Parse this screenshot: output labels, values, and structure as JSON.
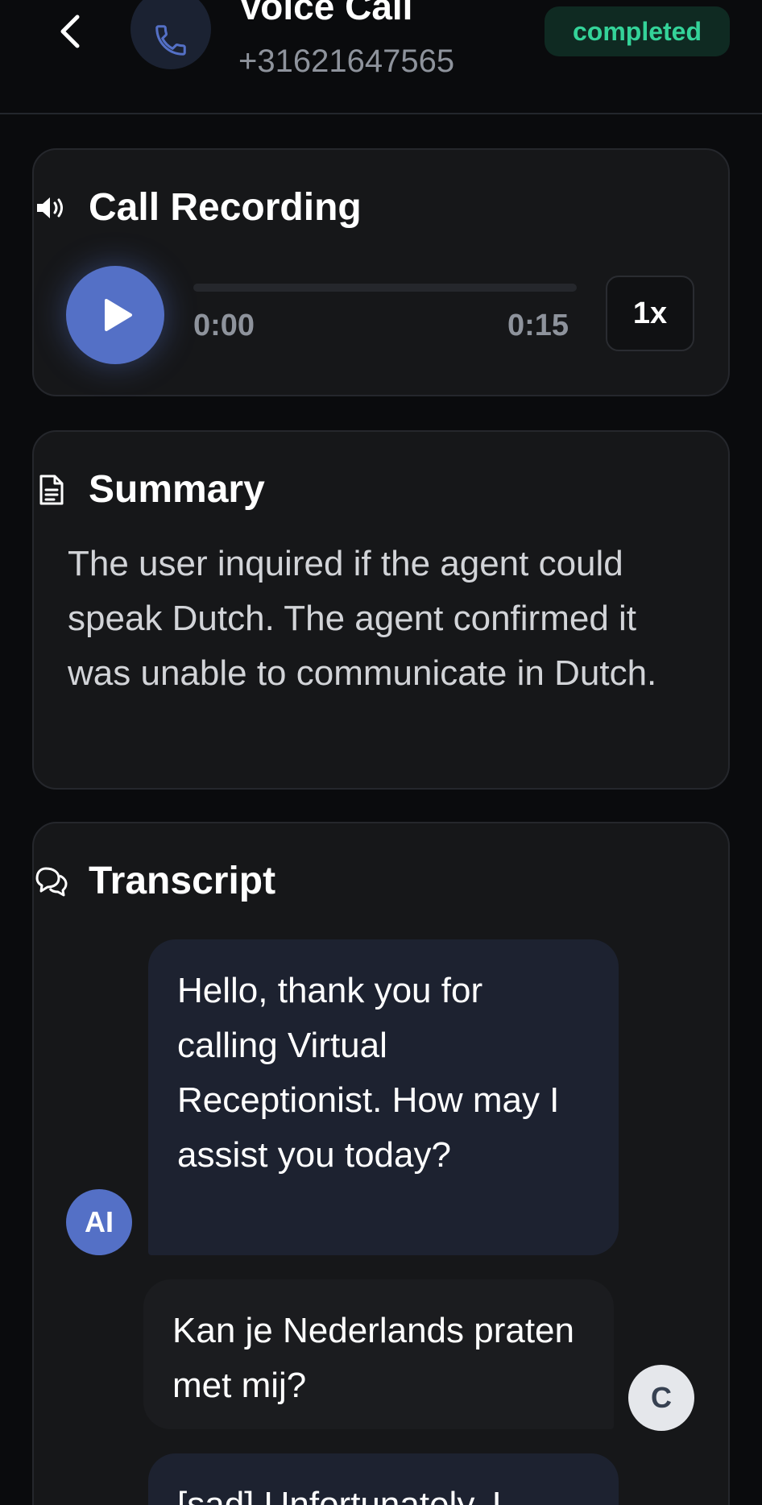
{
  "header": {
    "title": "Voice Call",
    "phone": "+31621647565",
    "status": "completed"
  },
  "recording": {
    "title": "Call Recording",
    "current_time": "0:00",
    "total_time": "0:15",
    "progress": 0,
    "speed": "1x"
  },
  "summary": {
    "title": "Summary",
    "text": "The user inquired if the agent could speak Dutch. The agent confirmed it was unable to communicate in Dutch."
  },
  "transcript": {
    "title": "Transcript",
    "messages": [
      {
        "role": "agent",
        "avatar": "AI",
        "text": "Hello, thank you for calling Virtual Receptionist. How may I assist you today?"
      },
      {
        "role": "user",
        "avatar": "C",
        "text": "Kan je Nederlands praten met mij?"
      },
      {
        "role": "agent",
        "avatar": "AI",
        "text": "[sad] Unfortunately, I"
      }
    ]
  },
  "colors": {
    "accent": "#5470c6",
    "status_text": "#34d399",
    "status_bg": "#0f2a22",
    "card_bg": "#161719",
    "page_bg": "#0a0b0d"
  },
  "icons": {
    "back": "chevron-left-icon",
    "call": "phone-icon",
    "recording": "speaker-icon",
    "play": "play-icon",
    "summary": "document-icon",
    "transcript": "chat-bubbles-icon"
  }
}
